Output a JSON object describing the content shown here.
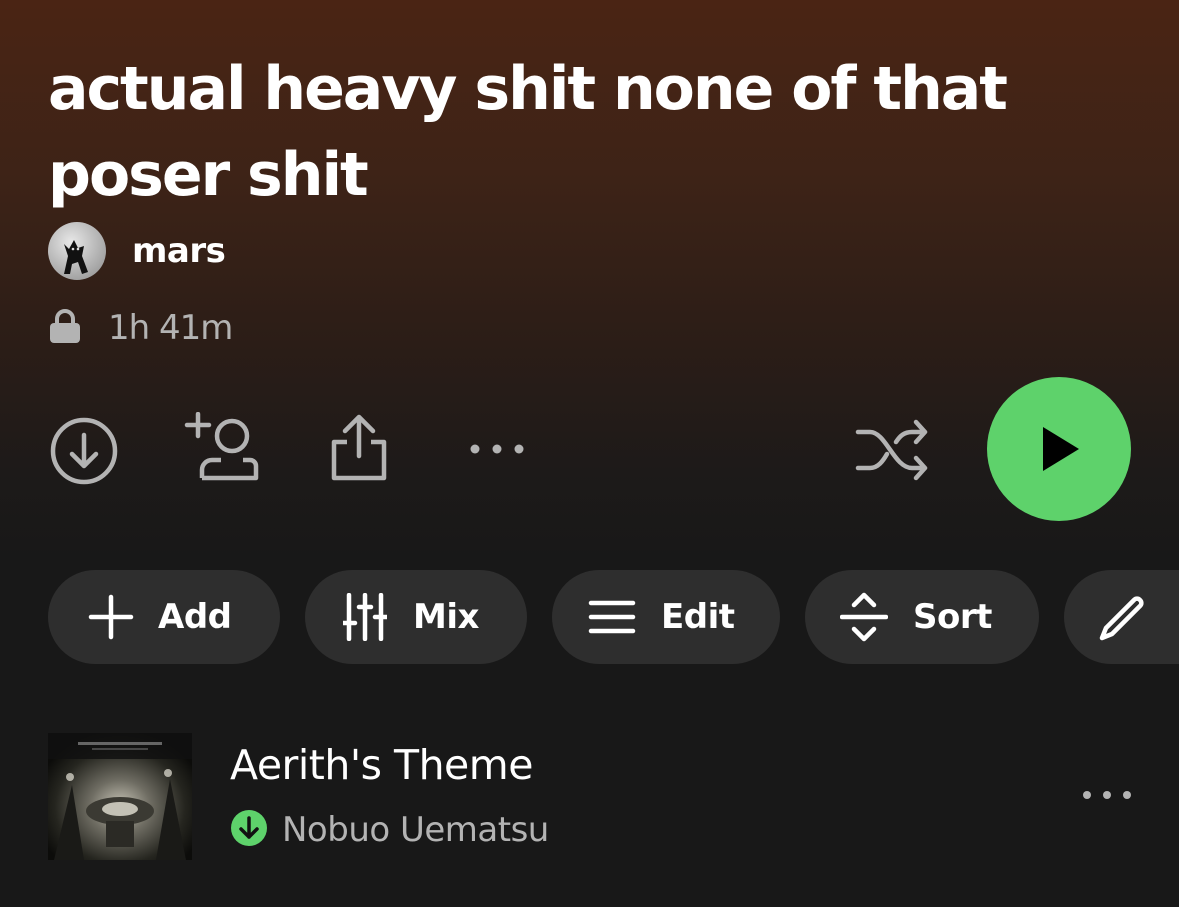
{
  "playlist": {
    "title": "actual heavy shit none of that poser shit",
    "owner": "mars",
    "duration": "1h 41m",
    "privacy_icon": "lock-icon"
  },
  "actions": {
    "download_icon": "download-icon",
    "add_collaborator_icon": "add-user-icon",
    "share_icon": "share-icon",
    "more_icon": "more-horizontal-icon",
    "shuffle_icon": "shuffle-icon",
    "play_icon": "play-icon"
  },
  "chips": [
    {
      "label": "Add",
      "icon": "plus-icon"
    },
    {
      "label": "Mix",
      "icon": "sliders-icon"
    },
    {
      "label": "Edit",
      "icon": "list-icon"
    },
    {
      "label": "Sort",
      "icon": "sort-icon"
    },
    {
      "label": "",
      "icon": "pencil-icon"
    }
  ],
  "tracks": [
    {
      "title": "Aerith's Theme",
      "artist": "Nobuo Uematsu",
      "downloaded": true
    }
  ],
  "colors": {
    "accent": "#5ed26b",
    "chip_bg": "#2e2e2e",
    "muted_text": "#b3b3b3",
    "header_gradient_top": "#4a2414",
    "background": "#181818"
  }
}
